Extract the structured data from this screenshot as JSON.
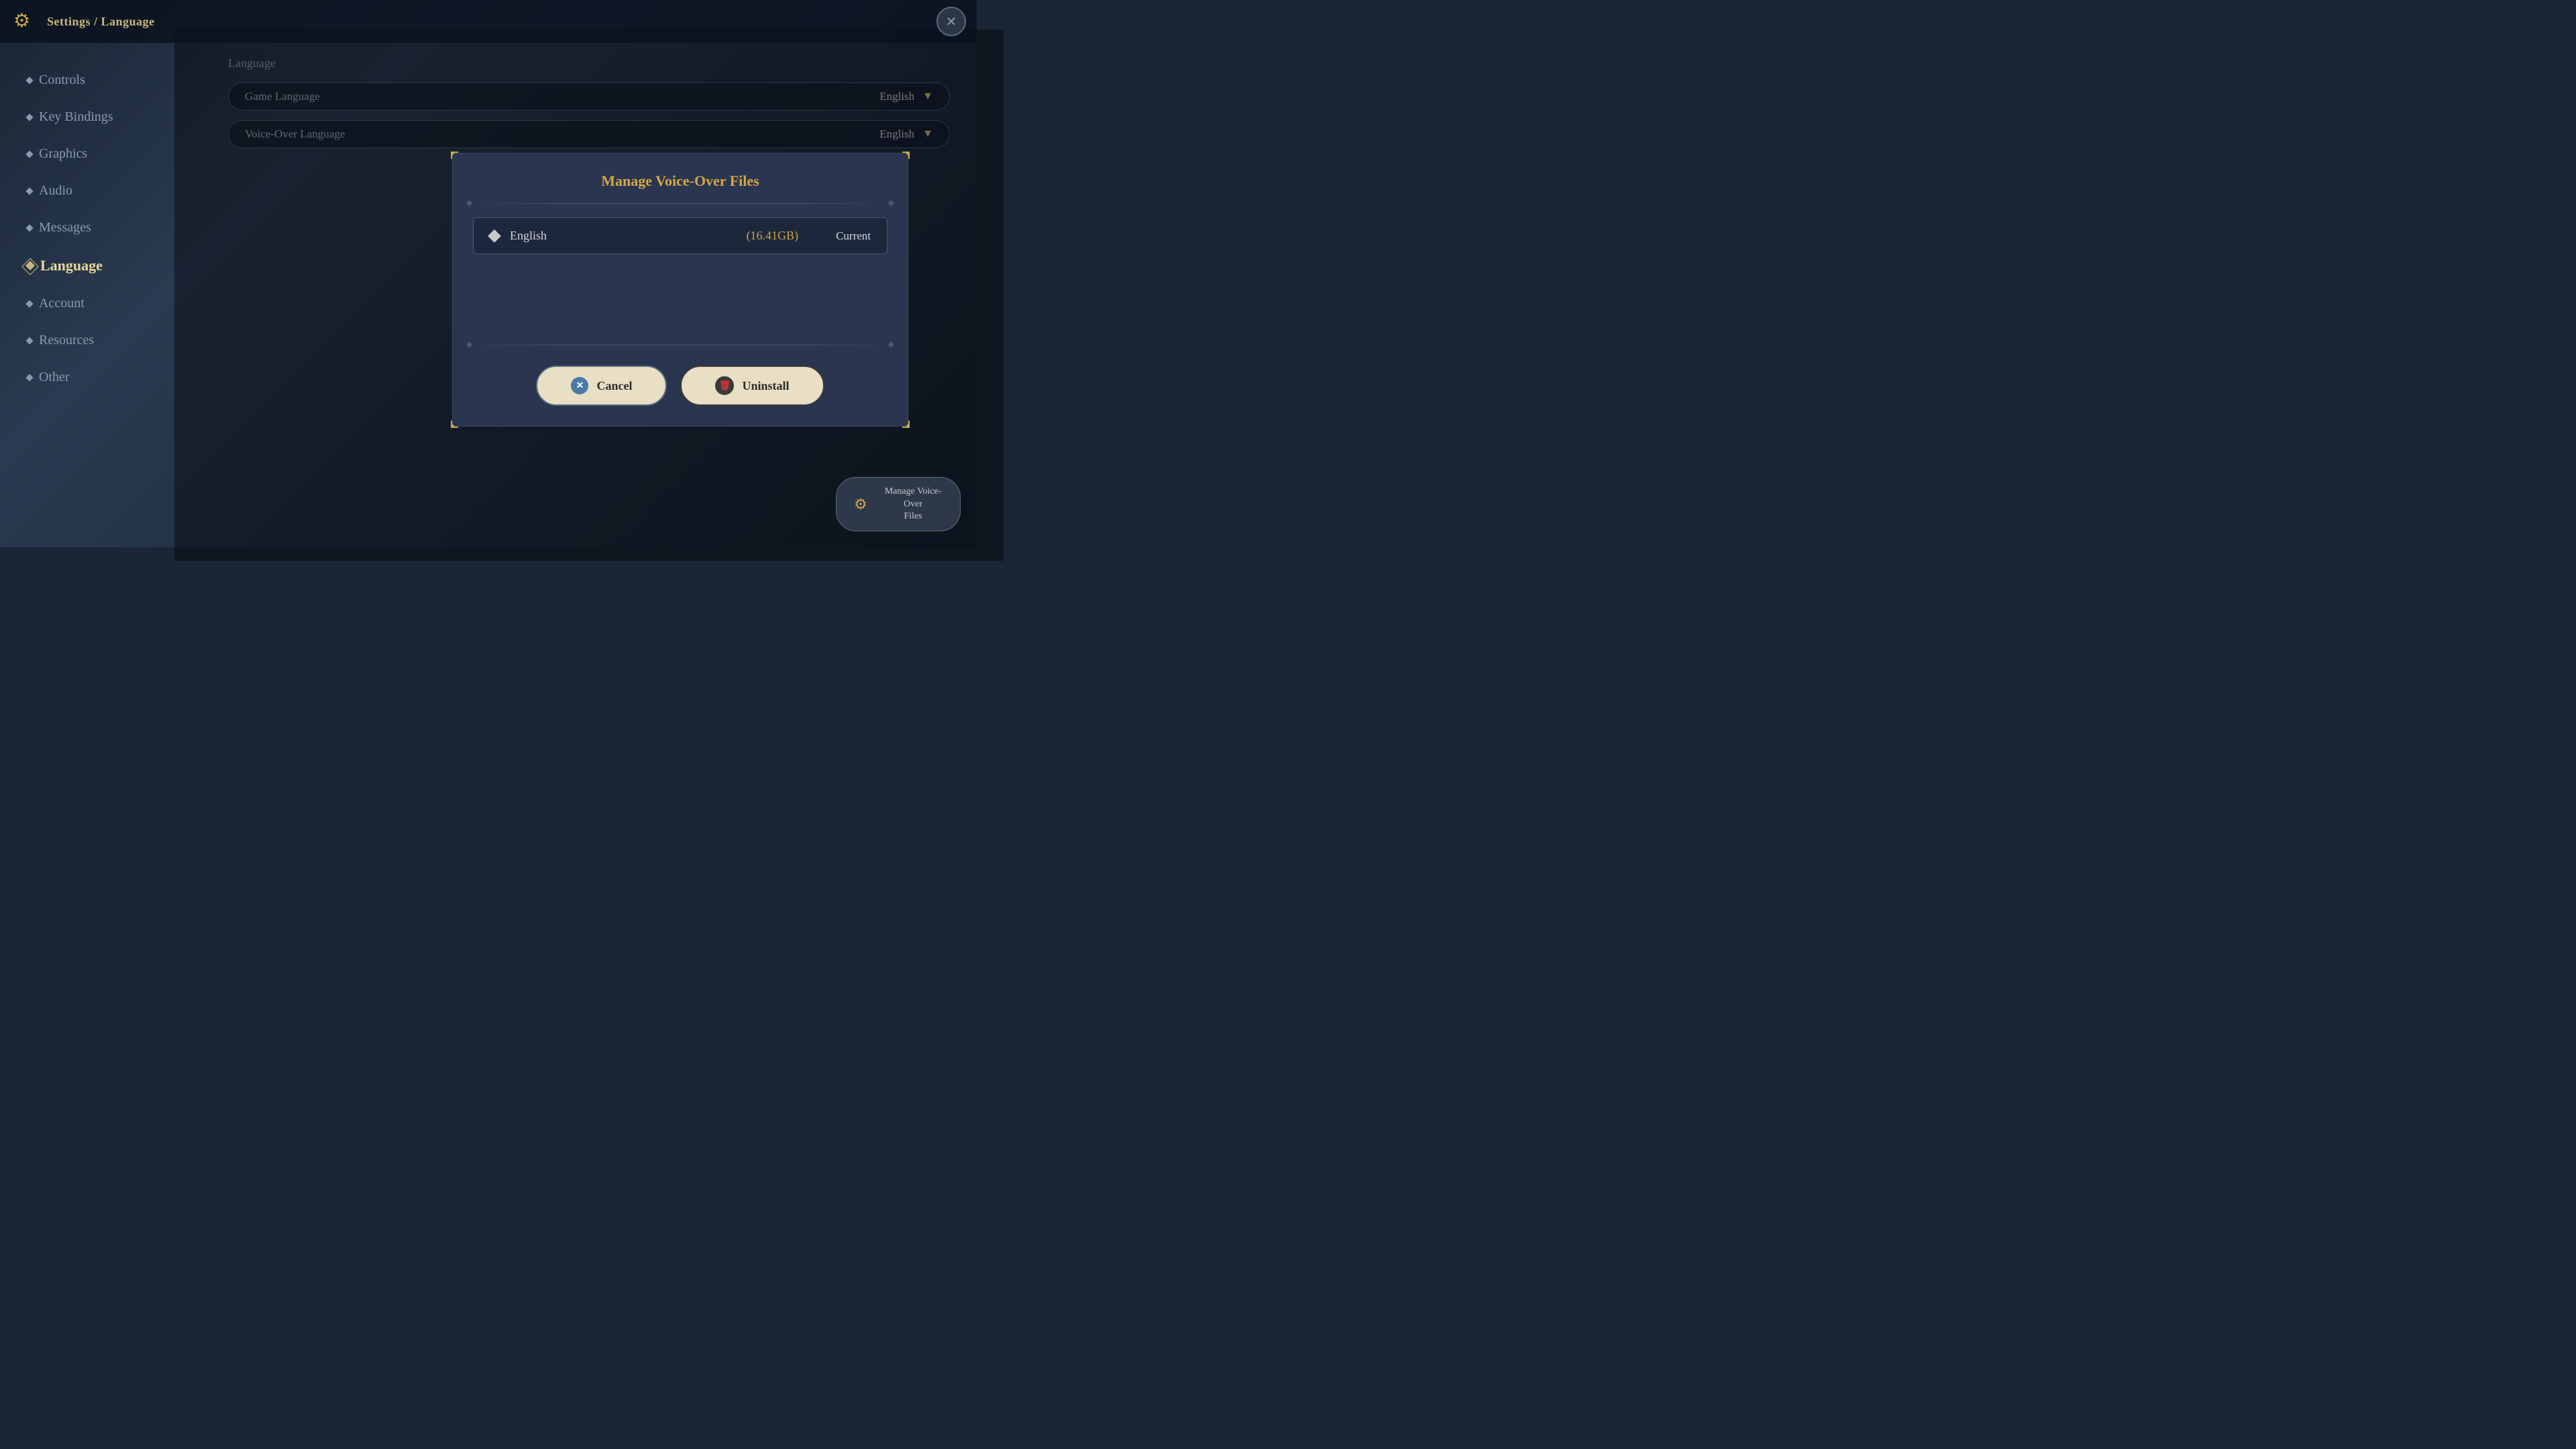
{
  "header": {
    "breadcrumb": "Settings / Language",
    "close_label": "✕"
  },
  "sidebar": {
    "items": [
      {
        "id": "controls",
        "label": "Controls",
        "active": false
      },
      {
        "id": "key-bindings",
        "label": "Key Bindings",
        "active": false
      },
      {
        "id": "graphics",
        "label": "Graphics",
        "active": false
      },
      {
        "id": "audio",
        "label": "Audio",
        "active": false
      },
      {
        "id": "messages",
        "label": "Messages",
        "active": false
      },
      {
        "id": "language",
        "label": "Language",
        "active": true
      },
      {
        "id": "account",
        "label": "Account",
        "active": false
      },
      {
        "id": "resources",
        "label": "Resources",
        "active": false
      },
      {
        "id": "other",
        "label": "Other",
        "active": false
      }
    ]
  },
  "content": {
    "section_title": "Language",
    "dropdowns": [
      {
        "label": "Game Language",
        "value": "English"
      },
      {
        "label": "Voice-Over Language",
        "value": "English"
      }
    ]
  },
  "modal": {
    "title": "Manage Voice-Over Files",
    "voice_items": [
      {
        "name": "English",
        "size": "(16.41GB)",
        "status": "Current"
      }
    ],
    "buttons": {
      "cancel": "Cancel",
      "uninstall": "Uninstall"
    }
  },
  "manage_button": {
    "label": "Manage Voice-Over\nFiles"
  },
  "icons": {
    "gear": "⚙",
    "close_x": "✕",
    "diamond": "◆",
    "trash": "🗑",
    "cancel_x": "✕",
    "chevron_down": "▼"
  }
}
